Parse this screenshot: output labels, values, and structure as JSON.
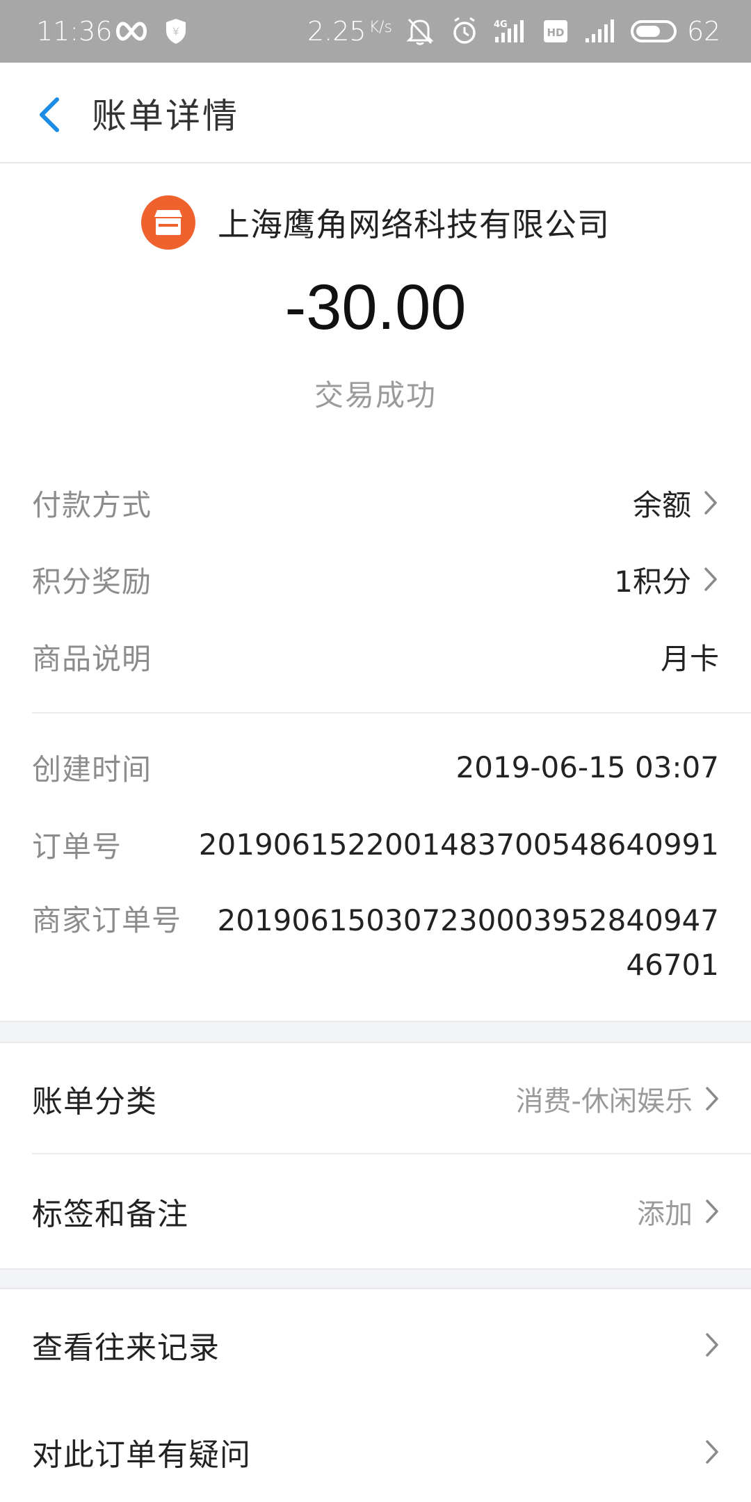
{
  "status_bar": {
    "time": "11:36",
    "net_speed": "2.25",
    "net_speed_unit": "K/s",
    "network_type": "4G",
    "hd_label": "HD",
    "battery_level": "62"
  },
  "header": {
    "title": "账单详情"
  },
  "merchant": {
    "name": "上海鹰角网络科技有限公司",
    "logo_icon": "shop-icon",
    "logo_color": "#f0622d"
  },
  "transaction": {
    "amount": "-30.00",
    "status": "交易成功"
  },
  "details": {
    "payment_method_label": "付款方式",
    "payment_method_value": "余额",
    "points_label": "积分奖励",
    "points_value": "1积分",
    "product_label": "商品说明",
    "product_value": "月卡",
    "created_label": "创建时间",
    "created_value": "2019-06-15 03:07",
    "order_no_label": "订单号",
    "order_no_value": "2019061522001483700548640991",
    "merchant_order_label": "商家订单号",
    "merchant_order_value": "2019061503072300039528409474670​1"
  },
  "actions": {
    "category_label": "账单分类",
    "category_value": "消费-休闲娱乐",
    "tags_label": "标签和备注",
    "tags_value": "添加",
    "history_label": "查看往来记录",
    "question_label": "对此订单有疑问"
  },
  "colors": {
    "accent_blue": "#1a8ce5",
    "status_bar_bg": "#a7a7a7",
    "band_bg": "#f3f4f7"
  }
}
